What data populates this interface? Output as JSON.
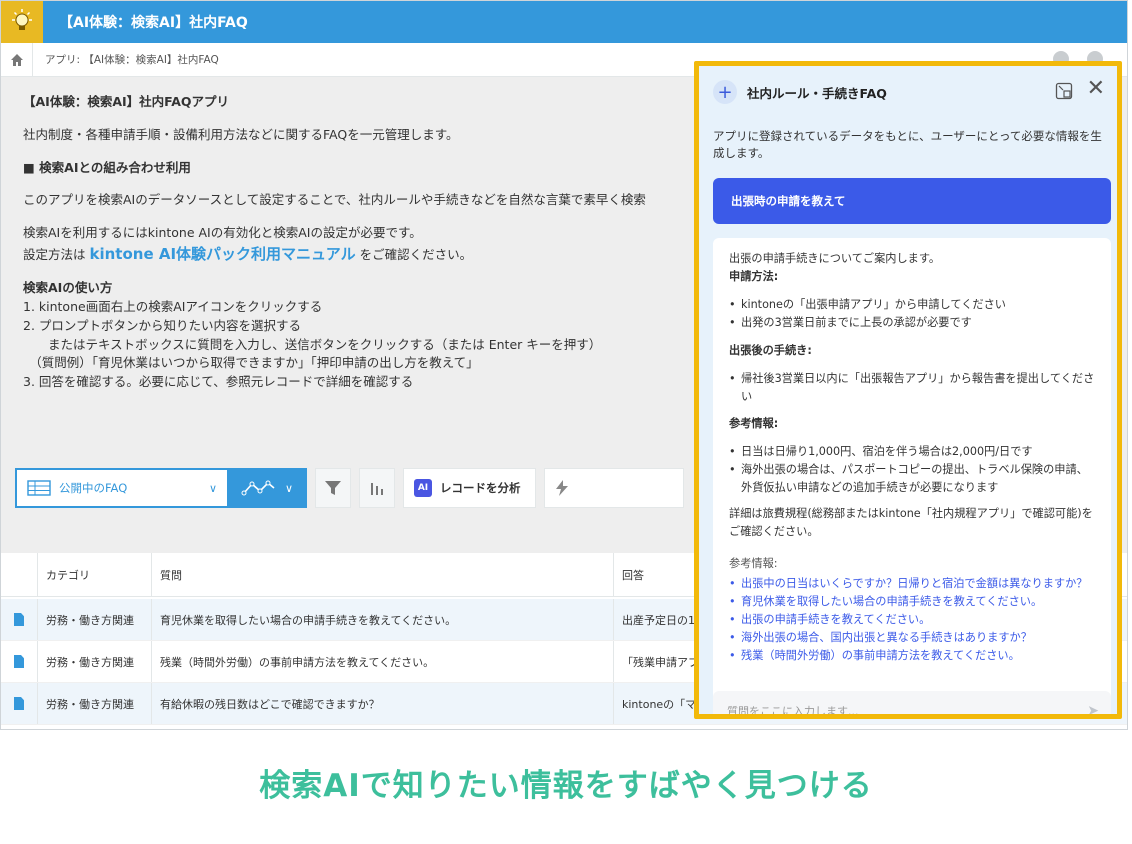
{
  "titlebar": {
    "title": "【AI体験：検索AI】社内FAQ"
  },
  "breadcrumb": {
    "text": "アプリ: 【AI体験：検索AI】社内FAQ"
  },
  "description": {
    "title": "【AI体験：検索AI】社内FAQアプリ",
    "summary": "社内制度・各種申請手順・設備利用方法などに関するFAQを一元管理します。",
    "section1_heading": "■ 検索AIとの組み合わせ利用",
    "section1_text": "このアプリを検索AIのデータソースとして設定することで、社内ルールや手続きなどを自然な言葉で素早く検索",
    "req_line1": "検索AIを利用するにはkintone AIの有効化と検索AIの設定が必要です。",
    "req_prefix": "設定方法は",
    "manual_link": "kintone AI体験パック利用マニュアル",
    "req_suffix": "をご確認ください。",
    "usage_heading": "検索AIの使い方",
    "steps": [
      "1. kintone画面右上の検索AIアイコンをクリックする",
      "2. プロンプトボタンから知りたい内容を選択する",
      "　　またはテキストボックスに質問を入力し、送信ボタンをクリックする（または Enter キーを押す）",
      "　（質問例）「育児休業はいつから取得できますか」「押印申請の出し方を教えて」",
      "3. 回答を確認する。必要に応じて、参照元レコードで詳細を確認する"
    ]
  },
  "toolbar": {
    "view_label": "公開中のFAQ",
    "analyze_label": "レコードを分析",
    "ai_badge": "AI"
  },
  "table": {
    "headers": [
      "カテゴリ",
      "質問",
      "回答"
    ],
    "rows": [
      {
        "category": "労務・働き方関連",
        "question": "育児休業を取得したい場合の申請手続きを教えてください。",
        "answer": "出産予定日の1"
      },
      {
        "category": "労務・働き方関連",
        "question": "残業（時間外労働）の事前申請方法を教えてください。",
        "answer": "「残業申請アプ"
      },
      {
        "category": "労務・働き方関連",
        "question": "有給休暇の残日数はどこで確認できますか？",
        "answer": "kintoneの「マ"
      }
    ]
  },
  "chat": {
    "title": "社内ルール・手続きFAQ",
    "intro": "アプリに登録されているデータをもとに、ユーザーにとって必要な情報を生成します。",
    "user_message": "出張時の申請を教えて",
    "answer": {
      "lead": "出張の申請手続きについてご案内します。",
      "h1": "申請方法:",
      "list1": [
        "kintoneの「出張申請アプリ」から申請してください",
        "出発の3営業日前までに上長の承認が必要です"
      ],
      "h2": "出張後の手続き:",
      "list2": [
        "帰社後3営業日以内に「出張報告アプリ」から報告書を提出してください"
      ],
      "h3": "参考情報:",
      "list3": [
        "日当は日帰り1,000円、宿泊を伴う場合は2,000円/日です",
        "海外出張の場合は、パスポートコピーの提出、トラベル保険の申請、外貨仮払い申請などの追加手続きが必要になります"
      ],
      "detail": "詳細は旅費規程(総務部またはkintone「社内規程アプリ」で確認可能)をご確認ください。",
      "ref_heading": "参考情報:",
      "refs": [
        "出張中の日当はいくらですか？日帰りと宿泊で金額は異なりますか？",
        "育児休業を取得したい場合の申請手続きを教えてください。",
        "出張の申請手続きを教えてください。",
        "海外出張の場合、国内出張と異なる手続きはありますか？",
        "残業（時間外労働）の事前申請方法を教えてください。"
      ]
    },
    "input_placeholder": "質問をここに入力します..."
  },
  "caption": "検索AIで知りたい情報をすばやく見つける",
  "colors": {
    "brand": "#3498db",
    "highlight": "#f2b90a",
    "accent": "#3dbf9c",
    "chat_user": "#3b5ae8"
  }
}
